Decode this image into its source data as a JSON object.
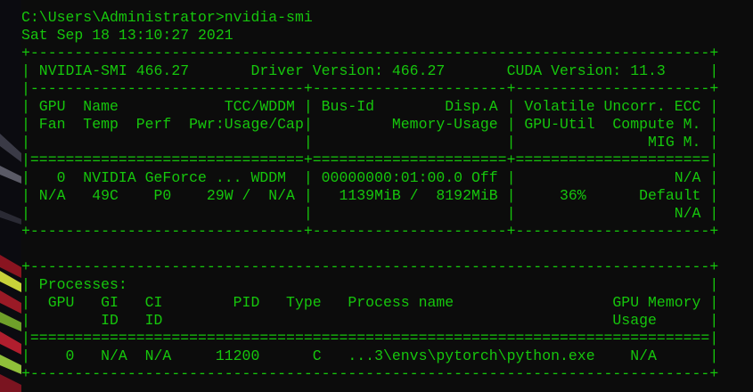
{
  "theme": {
    "background": "#0c0c0c",
    "text_color": "#16c60c"
  },
  "terminal": {
    "lines": [
      "C:\\Users\\Administrator>nvidia-smi",
      "Sat Sep 18 13:10:27 2021",
      "+-----------------------------------------------------------------------------+",
      "| NVIDIA-SMI 466.27       Driver Version: 466.27       CUDA Version: 11.3     |",
      "|-------------------------------+----------------------+----------------------+",
      "| GPU  Name            TCC/WDDM | Bus-Id        Disp.A | Volatile Uncorr. ECC |",
      "| Fan  Temp  Perf  Pwr:Usage/Cap|         Memory-Usage | GPU-Util  Compute M. |",
      "|                               |                      |               MIG M. |",
      "|===============================+======================+======================|",
      "|   0  NVIDIA GeForce ... WDDM  | 00000000:01:00.0 Off |                  N/A |",
      "| N/A   49C    P0    29W /  N/A |   1139MiB /  8192MiB |     36%      Default |",
      "|                               |                      |                  N/A |",
      "+-------------------------------+----------------------+----------------------+",
      "",
      "+-----------------------------------------------------------------------------+",
      "| Processes:                                                                  |",
      "|  GPU   GI   CI        PID   Type   Process name                  GPU Memory |",
      "|        ID   ID                                                   Usage      |",
      "|=============================================================================|",
      "|    0   N/A  N/A     11200      C   ...3\\envs\\pytorch\\python.exe    N/A      |",
      "+-----------------------------------------------------------------------------+"
    ]
  }
}
